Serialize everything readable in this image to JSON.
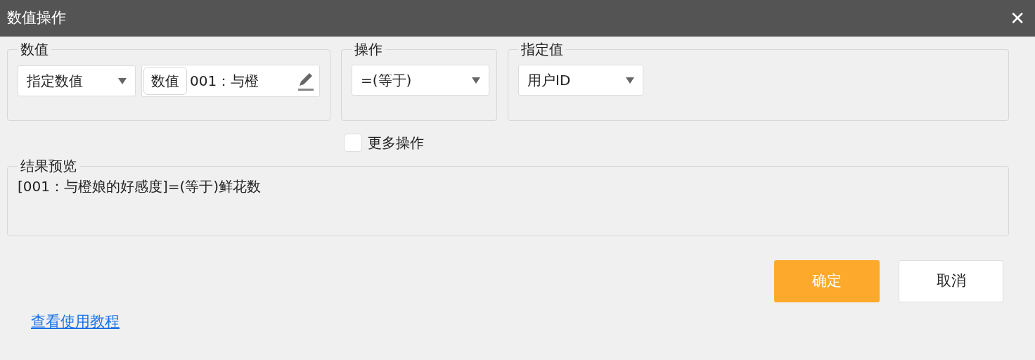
{
  "window": {
    "title": "数值操作",
    "close": "✕"
  },
  "value_group": {
    "label": "数值",
    "source_select": "指定数值",
    "field": {
      "tag": "数值",
      "text": "001：与橙"
    }
  },
  "operation_group": {
    "label": "操作",
    "select": "=(等于)"
  },
  "target_group": {
    "label": "指定值",
    "select": "用户ID"
  },
  "more_operations": {
    "label": "更多操作",
    "checked": false
  },
  "preview": {
    "label": "结果预览",
    "text": "[001：与橙娘的好感度]=(等于)鲜花数"
  },
  "buttons": [
    {
      "label": "确定",
      "kind": "primary"
    },
    {
      "label": "取消",
      "kind": "secondary"
    }
  ],
  "help_link": "查看使用教程"
}
